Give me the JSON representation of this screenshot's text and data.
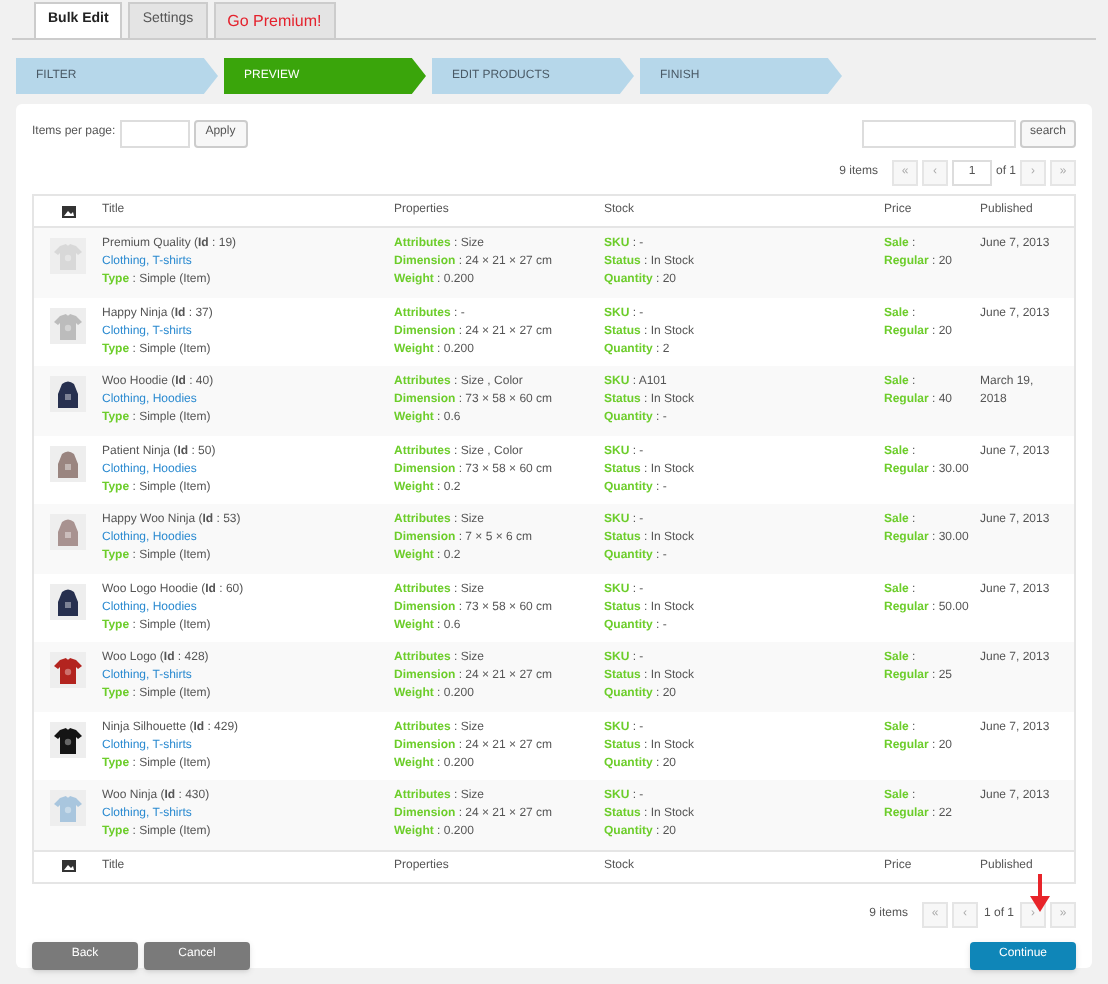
{
  "tabs": [
    {
      "label": "Bulk Edit",
      "selected": true,
      "kind": "normal"
    },
    {
      "label": "Settings",
      "selected": false,
      "kind": "normal"
    },
    {
      "label": "Go Premium!",
      "selected": false,
      "kind": "premium"
    }
  ],
  "steps": [
    {
      "label": "FILTER",
      "selected": false
    },
    {
      "label": "PREVIEW",
      "selected": true
    },
    {
      "label": "EDIT PRODUCTS",
      "selected": false
    },
    {
      "label": "FINISH",
      "selected": false
    }
  ],
  "items_per_page": {
    "label": "Items per page:",
    "button": "Apply"
  },
  "search": {
    "button": "search"
  },
  "pagination_top": {
    "count": "9 items",
    "first": "«",
    "prev": "‹",
    "page": "1",
    "of": "of 1",
    "next": "›",
    "last": "»"
  },
  "columns": [
    "Title",
    "Properties",
    "Stock",
    "Price",
    "Published"
  ],
  "rows": [
    {
      "title": "Premium Quality (**Id** : 19)",
      "categories": "Clothing, T-shirts",
      "type": "**Type** : Simple (Item)",
      "attributes": "**Attributes** : Size",
      "dimension": "**Dimension** : 24 × 21 × 27 cm",
      "weight": "**Weight** : 0.200",
      "sku": "**SKU** : -",
      "status": "**Status** : In Stock",
      "quantity": "**Quantity** : 20",
      "sale": "**Sale** :",
      "regular": "**Regular** : 20",
      "published": "June 7, 2013"
    },
    {
      "title": "Happy Ninja (**Id** : 37)",
      "categories": "Clothing, T-shirts",
      "type": "**Type** : Simple (Item)",
      "attributes": "**Attributes** : -",
      "dimension": "**Dimension** : 24 × 21 × 27 cm",
      "weight": "**Weight** : 0.200",
      "sku": "**SKU** : -",
      "status": "**Status** : In Stock",
      "quantity": "**Quantity** : 2",
      "sale": "**Sale** :",
      "regular": "**Regular** : 20",
      "published": "June 7, 2013"
    },
    {
      "title": "Woo Hoodie (**Id** : 40)",
      "categories": "Clothing, Hoodies",
      "type": "**Type** : Simple (Item)",
      "attributes": "**Attributes** : Size , Color",
      "dimension": "**Dimension** : 73 × 58 × 60 cm",
      "weight": "**Weight** : 0.6",
      "sku": "**SKU** : A101",
      "status": "**Status** : In Stock",
      "quantity": "**Quantity** : -",
      "sale": "**Sale** :",
      "regular": "**Regular** : 40",
      "published": "March 19, 2018"
    },
    {
      "title": "Patient Ninja (**Id** : 50)",
      "categories": "Clothing, Hoodies",
      "type": "**Type** : Simple (Item)",
      "attributes": "**Attributes** : Size , Color",
      "dimension": "**Dimension** : 73 × 58 × 60 cm",
      "weight": "**Weight** : 0.2",
      "sku": "**SKU** : -",
      "status": "**Status** : In Stock",
      "quantity": "**Quantity** : -",
      "sale": "**Sale** :",
      "regular": "**Regular** : 30.00",
      "published": "June 7, 2013"
    },
    {
      "title": "Happy Woo Ninja (**Id** : 53)",
      "categories": "Clothing, Hoodies",
      "type": "**Type** : Simple (Item)",
      "attributes": "**Attributes** : Size",
      "dimension": "**Dimension** : 7 × 5 × 6 cm",
      "weight": "**Weight** : 0.2",
      "sku": "**SKU** : -",
      "status": "**Status** : In Stock",
      "quantity": "**Quantity** : -",
      "sale": "**Sale** :",
      "regular": "**Regular** : 30.00",
      "published": "June 7, 2013"
    },
    {
      "title": "Woo Logo Hoodie (**Id** : 60)",
      "categories": "Clothing, Hoodies",
      "type": "**Type** : Simple (Item)",
      "attributes": "**Attributes** : Size",
      "dimension": "**Dimension** : 73 × 58 × 60 cm",
      "weight": "**Weight** : 0.6",
      "sku": "**SKU** : -",
      "status": "**Status** : In Stock",
      "quantity": "**Quantity** : -",
      "sale": "**Sale** :",
      "regular": "**Regular** : 50.00",
      "published": "June 7, 2013"
    },
    {
      "title": "Woo Logo (**Id** : 428)",
      "categories": "Clothing, T-shirts",
      "type": "**Type** : Simple (Item)",
      "attributes": "**Attributes** : Size",
      "dimension": "**Dimension** : 24 × 21 × 27 cm",
      "weight": "**Weight** : 0.200",
      "sku": "**SKU** : -",
      "status": "**Status** : In Stock",
      "quantity": "**Quantity** : 20",
      "sale": "**Sale** :",
      "regular": "**Regular** : 25",
      "published": "June 7, 2013"
    },
    {
      "title": "Ninja Silhouette (**Id** : 429)",
      "categories": "Clothing, T-shirts",
      "type": "**Type** : Simple (Item)",
      "attributes": "**Attributes** : Size",
      "dimension": "**Dimension** : 24 × 21 × 27 cm",
      "weight": "**Weight** : 0.200",
      "sku": "**SKU** : -",
      "status": "**Status** : In Stock",
      "quantity": "**Quantity** : 20",
      "sale": "**Sale** :",
      "regular": "**Regular** : 20",
      "published": "June 7, 2013"
    },
    {
      "title": "Woo Ninja (**Id** : 430)",
      "categories": "Clothing, T-shirts",
      "type": "**Type** : Simple (Item)",
      "attributes": "**Attributes** : Size",
      "dimension": "**Dimension** : 24 × 21 × 27 cm",
      "weight": "**Weight** : 0.200",
      "sku": "**SKU** : -",
      "status": "**Status** : In Stock",
      "quantity": "**Quantity** : 20",
      "sale": "**Sale** :",
      "regular": "**Regular** : 22",
      "published": "June 7, 2013"
    }
  ],
  "footer_columns": [
    "Title",
    "Properties",
    "Stock",
    "Price",
    "Published"
  ],
  "pagination_bottom": {
    "count": "9 items",
    "first": "«",
    "prev": "‹",
    "page": "1 of 1",
    "next": "›",
    "last": "»"
  },
  "buttons": [
    {
      "label": "Back",
      "kind": "secondary"
    },
    {
      "label": "Cancel",
      "kind": "secondary"
    },
    {
      "label": "Continue",
      "kind": "primary"
    }
  ]
}
